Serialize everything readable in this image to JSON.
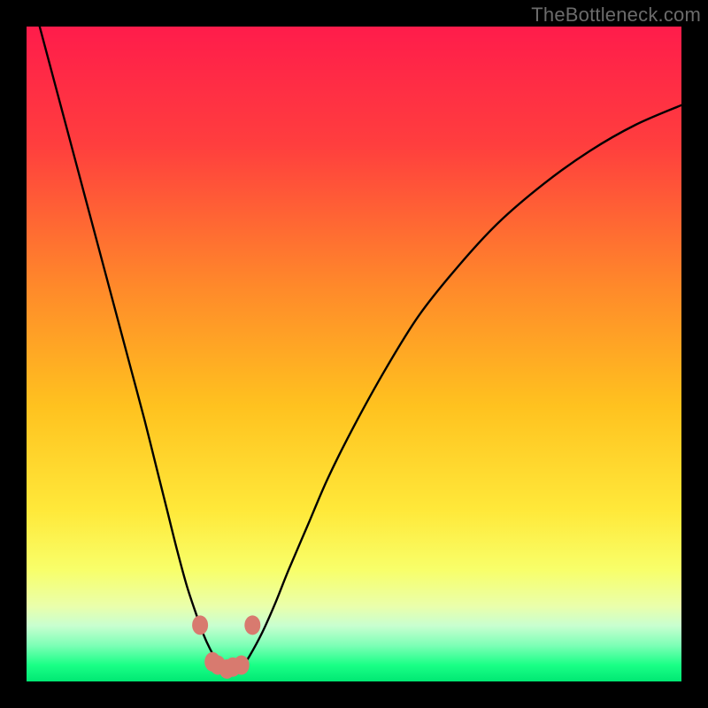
{
  "watermark": {
    "text": "TheBottleneck.com"
  },
  "colors": {
    "black": "#000000",
    "curve": "#000000",
    "marker_fill": "#d87a6f",
    "marker_stroke": "#c54f43",
    "gradient_stops": [
      {
        "offset": 0.0,
        "color": "#ff1c4b"
      },
      {
        "offset": 0.18,
        "color": "#ff3e3e"
      },
      {
        "offset": 0.4,
        "color": "#ff8a2a"
      },
      {
        "offset": 0.58,
        "color": "#ffc21f"
      },
      {
        "offset": 0.74,
        "color": "#ffe93a"
      },
      {
        "offset": 0.83,
        "color": "#f8ff6a"
      },
      {
        "offset": 0.885,
        "color": "#eaffab"
      },
      {
        "offset": 0.915,
        "color": "#c8ffd0"
      },
      {
        "offset": 0.945,
        "color": "#7dffb6"
      },
      {
        "offset": 0.975,
        "color": "#1aff86"
      },
      {
        "offset": 1.0,
        "color": "#00e873"
      }
    ]
  },
  "chart_data": {
    "type": "line",
    "title": "",
    "xlabel": "",
    "ylabel": "",
    "xlim": [
      0,
      100
    ],
    "ylim": [
      0,
      100
    ],
    "grid": false,
    "series": [
      {
        "name": "bottleneck-curve",
        "x": [
          2,
          4,
          6,
          8,
          10,
          12,
          14,
          16,
          18,
          20,
          21.5,
          23,
          24.5,
          26,
          27,
          28,
          29,
          30,
          31,
          32,
          33,
          34,
          36,
          38,
          40,
          43,
          46,
          50,
          55,
          60,
          66,
          72,
          79,
          86,
          93,
          100
        ],
        "y": [
          100,
          92.5,
          85,
          77.5,
          70,
          62.5,
          55,
          47.5,
          40,
          32,
          26,
          20,
          14.5,
          10,
          7.2,
          5.0,
          3.3,
          2.2,
          1.7,
          1.7,
          2.4,
          3.8,
          7.5,
          12,
          17,
          24,
          31,
          39,
          48,
          56,
          63.5,
          70,
          76,
          81,
          85,
          88
        ]
      }
    ],
    "markers": [
      {
        "x": 26.5,
        "y": 8.6
      },
      {
        "x": 28.4,
        "y": 3.0
      },
      {
        "x": 29.2,
        "y": 2.5
      },
      {
        "x": 30.6,
        "y": 1.9
      },
      {
        "x": 31.5,
        "y": 2.2
      },
      {
        "x": 32.8,
        "y": 2.5
      },
      {
        "x": 34.5,
        "y": 8.6
      }
    ]
  }
}
